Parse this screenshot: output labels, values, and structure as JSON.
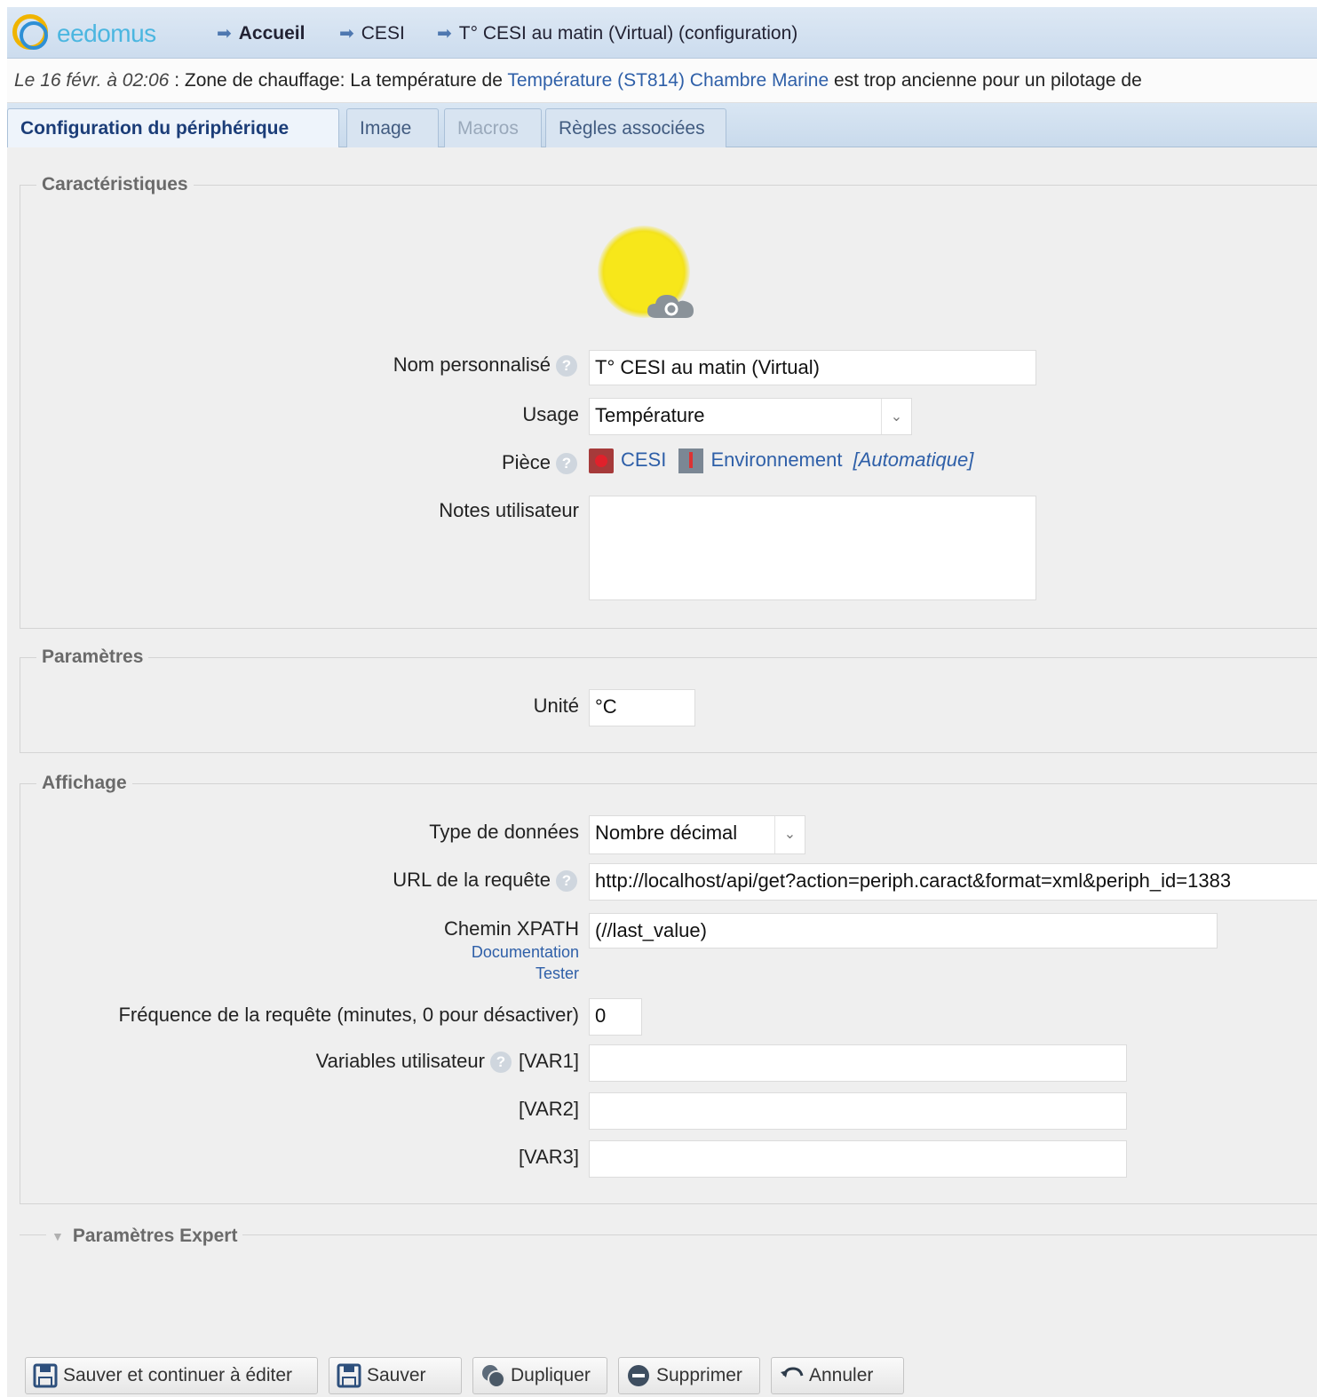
{
  "header": {
    "logo_text": "eedomus",
    "breadcrumb": [
      "Accueil",
      "CESI",
      "T° CESI au matin (Virtual) (configuration)"
    ]
  },
  "notice": {
    "date": "Le 16 févr. à 02:06",
    "before_link": " : Zone de chauffage: La température de ",
    "link": "Température (ST814) Chambre Marine",
    "after_link": " est trop ancienne pour un pilotage de"
  },
  "tabs": [
    {
      "label": "Configuration du périphérique",
      "state": "active"
    },
    {
      "label": "Image",
      "state": "normal"
    },
    {
      "label": "Macros",
      "state": "disabled"
    },
    {
      "label": "Règles associées",
      "state": "normal"
    }
  ],
  "characteristics": {
    "legend": "Caractéristiques",
    "name_label": "Nom personnalisé",
    "name_value": "T° CESI au matin (Virtual)",
    "usage_label": "Usage",
    "usage_value": "Température",
    "room_label": "Pièce",
    "room_value": "CESI",
    "room_category": "Environnement",
    "room_mode": "[Automatique]",
    "notes_label": "Notes utilisateur",
    "notes_value": ""
  },
  "parameters": {
    "legend": "Paramètres",
    "unit_label": "Unité",
    "unit_value": "°C"
  },
  "display": {
    "legend": "Affichage",
    "data_type_label": "Type de données",
    "data_type_value": "Nombre décimal",
    "url_label": "URL de la requête",
    "url_value": "http://localhost/api/get?action=periph.caract&format=xml&periph_id=1383",
    "xpath_label": "Chemin XPATH",
    "xpath_value": "(//last_value)",
    "doc_link": "Documentation",
    "test_link": "Tester",
    "freq_label": "Fréquence de la requête (minutes, 0 pour désactiver)",
    "freq_value": "0",
    "vars_label": "Variables utilisateur",
    "var1_label": "[VAR1]",
    "var2_label": "[VAR2]",
    "var3_label": "[VAR3]",
    "var1_value": "",
    "var2_value": "",
    "var3_value": ""
  },
  "expert": {
    "legend": "Paramètres Expert"
  },
  "buttons": {
    "save_continue": "Sauver et continuer à éditer",
    "save": "Sauver",
    "duplicate": "Dupliquer",
    "delete": "Supprimer",
    "cancel": "Annuler"
  },
  "colors": {
    "accent": "#2e5fa8",
    "room_color": "#d8262e",
    "tab_active_text": "#1b3d78"
  }
}
